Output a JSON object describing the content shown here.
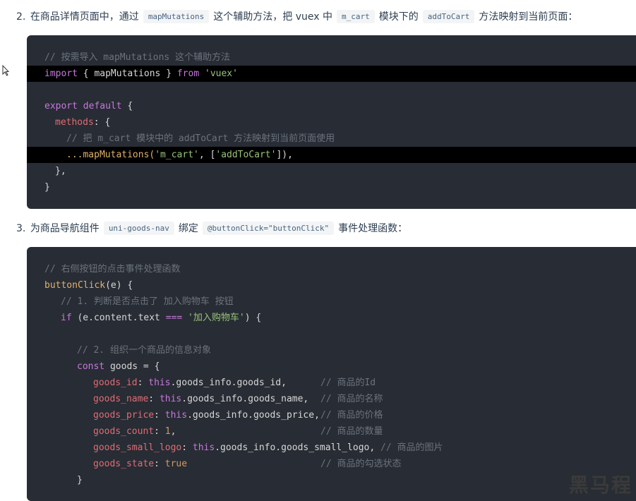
{
  "step2": {
    "num": "2.",
    "t1": "在商品详情页面中，通过",
    "c1": "mapMutations",
    "t2": "这个辅助方法，把 vuex 中",
    "c2": "m_cart",
    "t3": "模块下的",
    "c3": "addToCart",
    "t4": "方法映射到当前页面："
  },
  "code1": {
    "l1": "// 按需导入 mapMutations 这个辅助方法",
    "l2a": "import",
    "l2b": " { mapMutations } ",
    "l2c": "from",
    "l2d": "'vuex'",
    "l3a": "export default",
    "l3b": " {",
    "l4a": "methods",
    "l4b": ": {",
    "l5": "// 把 m_cart 模块中的 addToCart 方法映射到当前页面使用",
    "l6a": "...mapMutations(",
    "l6b": "'m_cart'",
    "l6c": ", [",
    "l6d": "'addToCart'",
    "l6e": "]),",
    "l7": "},",
    "l8": "}"
  },
  "step3": {
    "num": "3.",
    "t1": "为商品导航组件",
    "c1": "uni-goods-nav",
    "t2": "绑定",
    "c2": "@buttonClick=\"buttonClick\"",
    "t3": "事件处理函数："
  },
  "code2": {
    "l1": "// 右侧按钮的点击事件处理函数",
    "l2a": "buttonClick",
    "l2b": "(e) {",
    "l3": "// 1. 判断是否点击了 加入购物车 按钮",
    "l4a": "if",
    "l4b": " (e.content.text ",
    "l4c": "===",
    "l4d": "'加入购物车'",
    "l4e": ") {",
    "l5": "// 2. 组织一个商品的信息对象",
    "l6a": "const",
    "l6b": " goods = {",
    "f1k": "goods_id",
    "f1t": "this",
    "f1v": ".goods_info.goods_id,",
    "f1c": "// 商品的Id",
    "f2k": "goods_name",
    "f2t": "this",
    "f2v": ".goods_info.goods_name,",
    "f2c": "// 商品的名称",
    "f3k": "goods_price",
    "f3t": "this",
    "f3v": ".goods_info.goods_price,",
    "f3c": "// 商品的价格",
    "f4k": "goods_count",
    "f4v": "1",
    "f4c": "// 商品的数量",
    "f5k": "goods_small_logo",
    "f5t": "this",
    "f5v": ".goods_info.goods_small_logo,",
    "f5c": "// 商品的图片",
    "f6k": "goods_state",
    "f6v": "true",
    "f6c": "// 商品的勾选状态",
    "l13": "}"
  },
  "watermark": "黑马程"
}
